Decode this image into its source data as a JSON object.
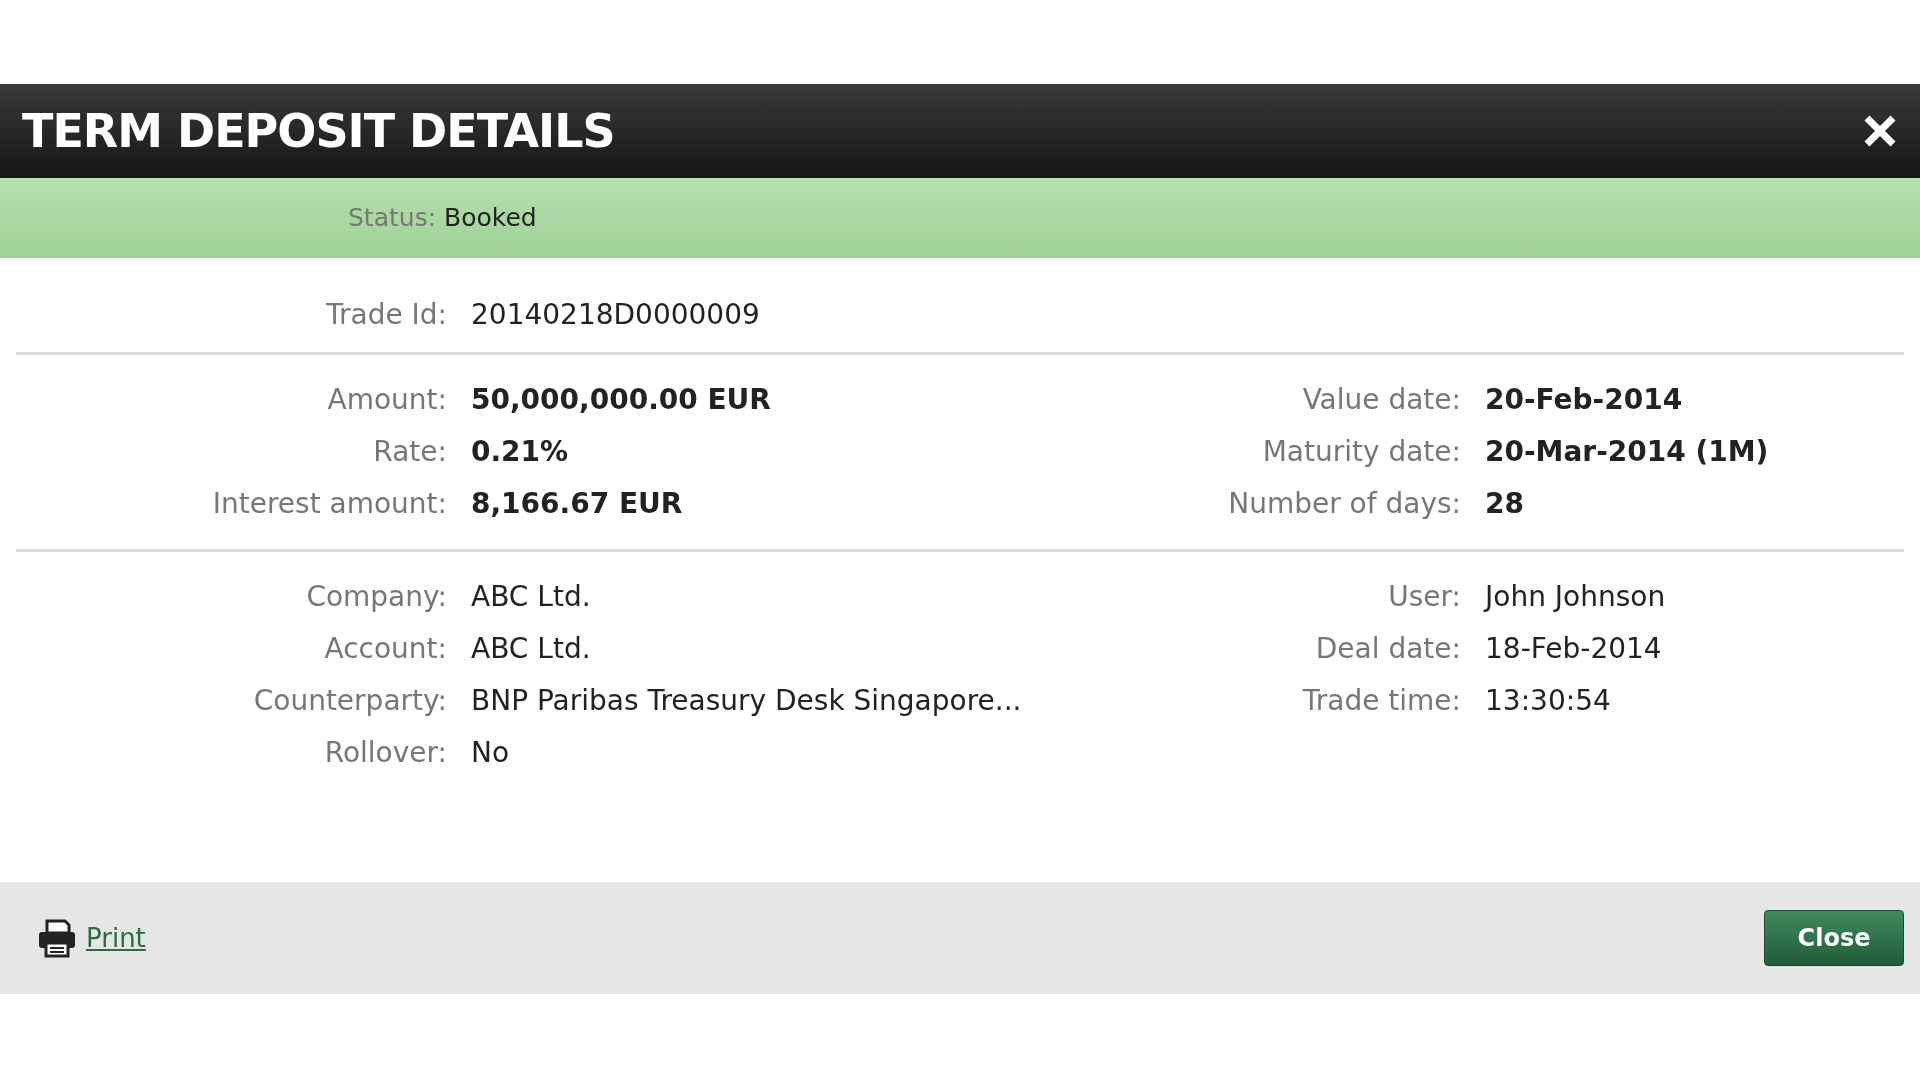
{
  "dialog": {
    "title": "TERM DEPOSIT DETAILS"
  },
  "status": {
    "label": "Status:",
    "value": "Booked"
  },
  "trade": {
    "label": "Trade Id:",
    "value": "20140218D0000009"
  },
  "sections": [
    {
      "bold": true,
      "left": [
        {
          "label": "Amount:",
          "value": "50,000,000.00 EUR"
        },
        {
          "label": "Rate:",
          "value": "0.21%"
        },
        {
          "label": "Interest amount:",
          "value": "8,166.67 EUR"
        }
      ],
      "right": [
        {
          "label": "Value date:",
          "value": "20-Feb-2014"
        },
        {
          "label": "Maturity date:",
          "value": "20-Mar-2014 (1M)"
        },
        {
          "label": "Number of days:",
          "value": "28"
        }
      ]
    },
    {
      "bold": false,
      "left": [
        {
          "label": "Company:",
          "value": "ABC Ltd."
        },
        {
          "label": "Account:",
          "value": "ABC Ltd."
        },
        {
          "label": "Counterparty:",
          "value": "BNP Paribas Treasury Desk Singapore..."
        },
        {
          "label": "Rollover:",
          "value": "No"
        }
      ],
      "right": [
        {
          "label": "User:",
          "value": "John Johnson"
        },
        {
          "label": "Deal date:",
          "value": "18-Feb-2014"
        },
        {
          "label": "Trade time:",
          "value": "13:30:54"
        }
      ]
    }
  ],
  "footer": {
    "print_link": "Print",
    "close_button": "Close"
  }
}
